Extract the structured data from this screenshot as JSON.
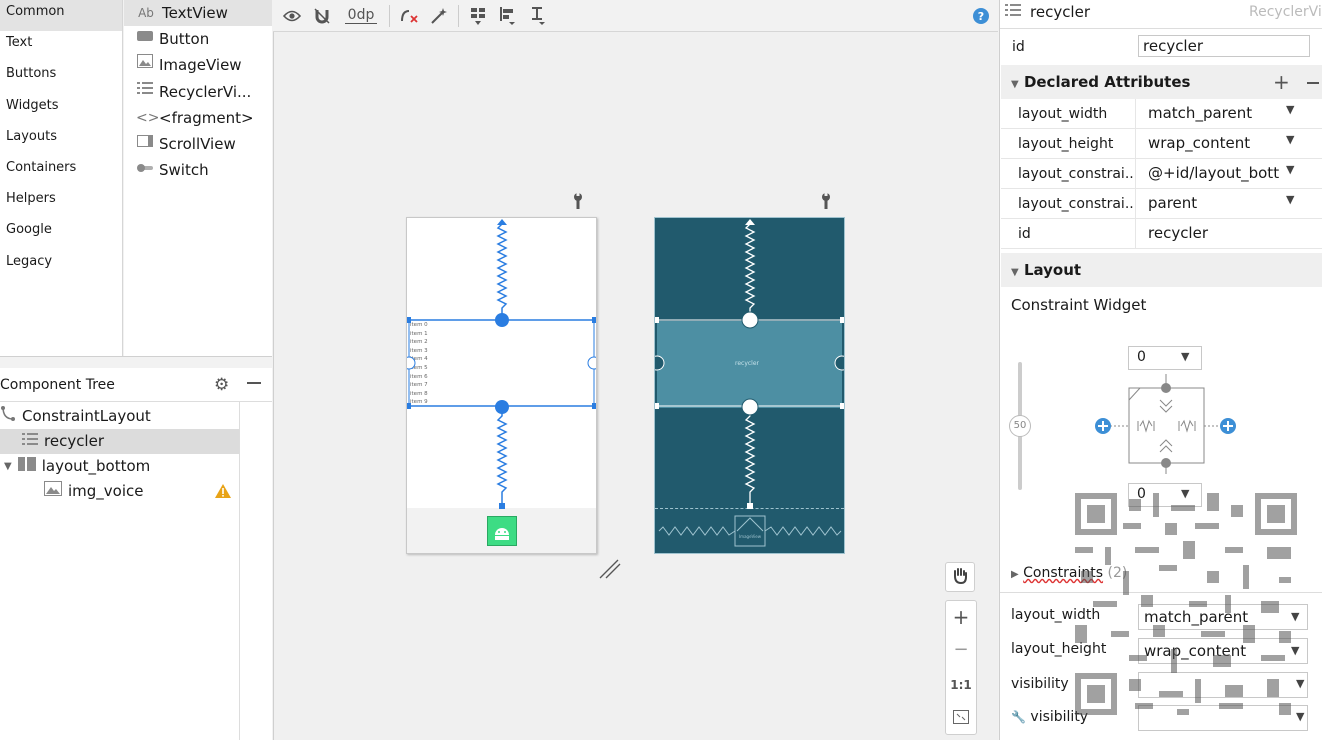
{
  "palette": {
    "categories": [
      "Common",
      "Text",
      "Buttons",
      "Widgets",
      "Layouts",
      "Containers",
      "Helpers",
      "Google",
      "Legacy"
    ],
    "selected_category": "Common",
    "widgets": [
      {
        "label": "TextView",
        "icon": "Ab"
      },
      {
        "label": "Button",
        "icon": "button-icon"
      },
      {
        "label": "ImageView",
        "icon": "image-icon"
      },
      {
        "label": "RecyclerVi...",
        "icon": "list-icon"
      },
      {
        "label": "<fragment>",
        "icon": "code-icon"
      },
      {
        "label": "ScrollView",
        "icon": "scroll-icon"
      },
      {
        "label": "Switch",
        "icon": "switch-icon"
      }
    ]
  },
  "component_tree": {
    "title": "Component Tree",
    "nodes": [
      {
        "label": "ConstraintLayout",
        "icon": "constraint-icon"
      },
      {
        "label": "recycler",
        "icon": "list-icon"
      },
      {
        "label": "layout_bottom",
        "icon": "linear-layout-icon"
      },
      {
        "label": "img_voice",
        "icon": "image-icon"
      }
    ]
  },
  "toolbar": {
    "margin_value": "0dp"
  },
  "design": {
    "items": [
      "item 0",
      "item 1",
      "item 2",
      "item 3",
      "item 4",
      "item 5",
      "item 6",
      "item 7",
      "item 8",
      "item 9"
    ],
    "blueprint_label": "recycler",
    "blueprint_image_label": "ImageView"
  },
  "zoom": {
    "zoom_in": "+",
    "zoom_out": "−",
    "one_to_one": "1:1"
  },
  "attributes": {
    "header_name": "recycler",
    "header_type": "RecyclerVi",
    "id_label": "id",
    "id_value": "recycler",
    "declared_title": "Declared Attributes",
    "declared": [
      {
        "key": "layout_width",
        "value": "match_parent"
      },
      {
        "key": "layout_height",
        "value": "wrap_content"
      },
      {
        "key": "layout_constrai...",
        "value": "@+id/layout_bott"
      },
      {
        "key": "layout_constrai...",
        "value": "parent"
      },
      {
        "key": "id",
        "value": "recycler"
      }
    ],
    "layout_title": "Layout",
    "constraint_widget_title": "Constraint Widget",
    "margin_top": "0",
    "margin_bottom": "0",
    "bias": "50",
    "constraints_label": "Constraints",
    "constraints_count": "(2)",
    "layout_rows": [
      {
        "key": "layout_width",
        "value": "match_parent"
      },
      {
        "key": "layout_height",
        "value": "wrap_content"
      },
      {
        "key": "visibility",
        "value": ""
      },
      {
        "key": "visibility",
        "value": ""
      }
    ]
  },
  "colors": {
    "accent": "#1a73e8",
    "blueprint_bg": "#215a6d",
    "blueprint_highlight": "#4d8fa3",
    "warning": "#e8a317"
  }
}
